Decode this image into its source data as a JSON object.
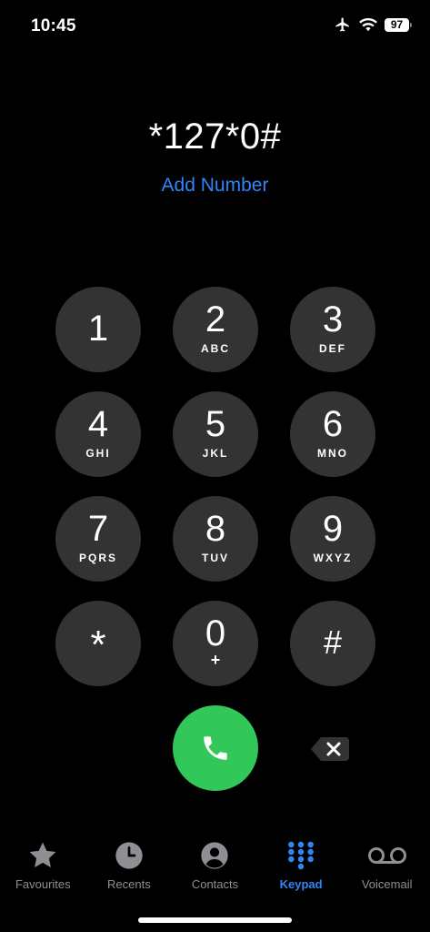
{
  "status_bar": {
    "time": "10:45",
    "battery": "97"
  },
  "dialer": {
    "number": "*127*0#",
    "add_number": "Add Number"
  },
  "keypad": {
    "keys": [
      {
        "digit": "1",
        "letters": ""
      },
      {
        "digit": "2",
        "letters": "ABC"
      },
      {
        "digit": "3",
        "letters": "DEF"
      },
      {
        "digit": "4",
        "letters": "GHI"
      },
      {
        "digit": "5",
        "letters": "JKL"
      },
      {
        "digit": "6",
        "letters": "MNO"
      },
      {
        "digit": "7",
        "letters": "PQRS"
      },
      {
        "digit": "8",
        "letters": "TUV"
      },
      {
        "digit": "9",
        "letters": "WXYZ"
      },
      {
        "digit": "*",
        "letters": ""
      },
      {
        "digit": "0",
        "letters": "+"
      },
      {
        "digit": "#",
        "letters": ""
      }
    ]
  },
  "colors": {
    "accent": "#2f86f6",
    "call_green": "#32c759",
    "key_gray": "#333333",
    "inactive_gray": "#8e8e93"
  },
  "tabs": [
    {
      "label": "Favourites",
      "icon": "star-icon",
      "active": false
    },
    {
      "label": "Recents",
      "icon": "clock-icon",
      "active": false
    },
    {
      "label": "Contacts",
      "icon": "person-icon",
      "active": false
    },
    {
      "label": "Keypad",
      "icon": "keypad-icon",
      "active": true
    },
    {
      "label": "Voicemail",
      "icon": "voicemail-icon",
      "active": false
    }
  ]
}
